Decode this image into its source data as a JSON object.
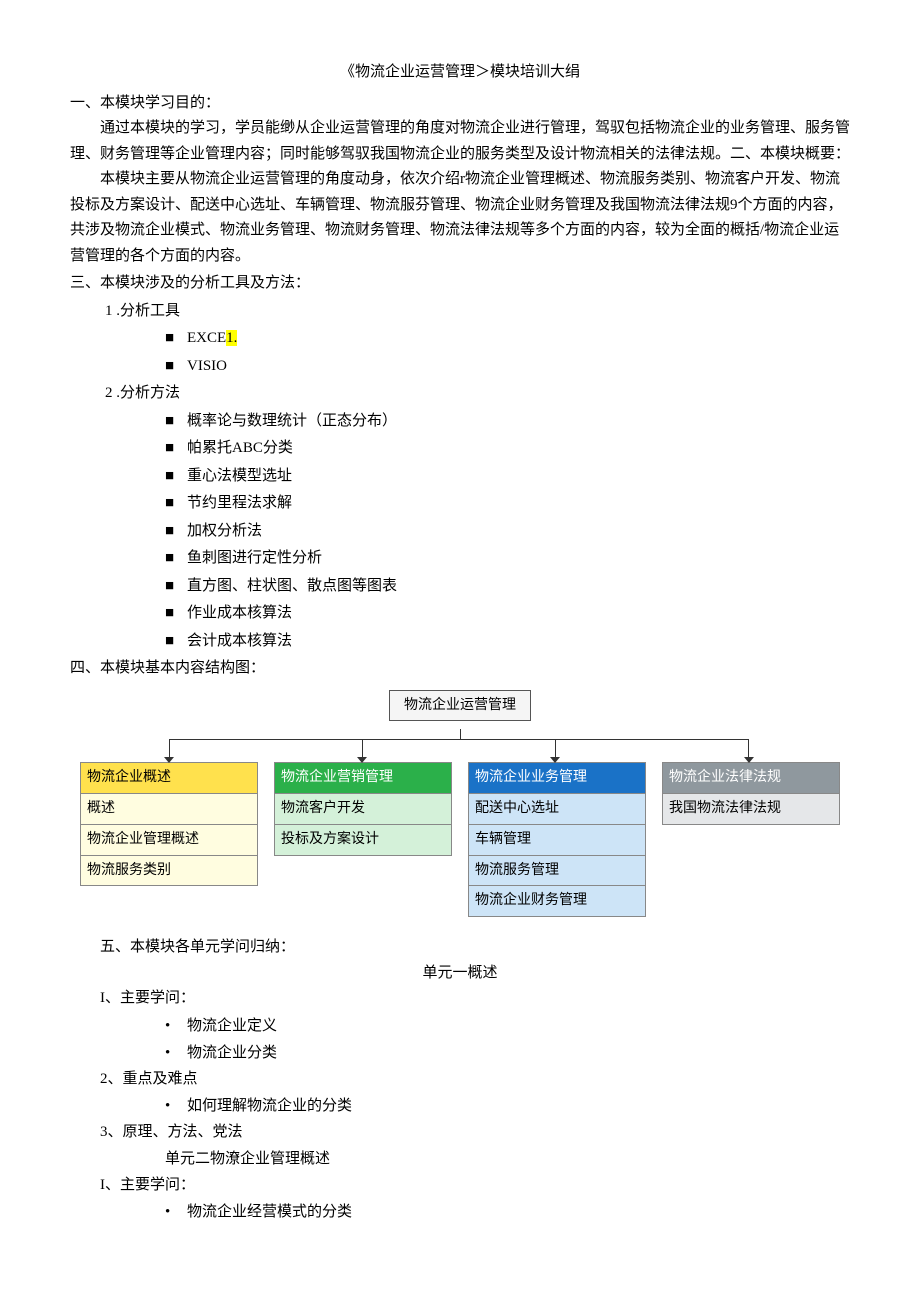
{
  "title": "《物流企业运营管理＞模块培训大绢",
  "s1": {
    "hd": "一、本模块学习目的：",
    "p1": "通过本模块的学习，学员能缈从企业运营管理的角度对物流企业进行管理，驾驭包括物流企业的业务管理、服务管理、财务管理等企业管理内容；同时能够驾驭我国物流企业的服务类型及设计物流相关的法律法规。二、本模块概要：",
    "p2": "本模块主要从物流企业运营管理的角度动身，依次介绍r物流企业管理概述、物流服务类别、物流客户开发、物流投标及方案设计、配送中心选址、车辆管理、物流服芬管理、物流企业财务管理及我国物流法律法规9个方面的内容，共涉及物流企业模式、物流业务管理、物流财务管理、物流法律法规等多个方面的内容，较为全面的概括/物流企业运营管理的各个方面的内容。"
  },
  "s3": {
    "hd": "三、本模块涉及的分析工具及方法：",
    "g1": "1 .分析工具",
    "g1a_prefix": "EXCE",
    "g1a_hl": "1.",
    "g1b": "VISIO",
    "g2": "2  .分析方法",
    "m1": "概率论与数理统计（正态分布）",
    "m2": "帕累托ABC分类",
    "m3": "重心法模型选址",
    "m4": "节约里程法求解",
    "m5": "加权分析法",
    "m6": "鱼刺图进行定性分析",
    "m7": "直方图、柱状图、散点图等图表",
    "m8": "作业成本核算法",
    "m9": "会计成本核算法"
  },
  "s4": {
    "hd": "四、本模块基本内容结构图：",
    "root": "物流企业运营管理",
    "c1h": "物流企业概述",
    "c1a": "概述",
    "c1b": "物流企业管理概述",
    "c1c": "物流服务类别",
    "c2h": "物流企业营销管理",
    "c2a": "物流客户开发",
    "c2b": "投标及方案设计",
    "c3h": "物流企业业务管理",
    "c3a": "配送中心选址",
    "c3b": "车辆管理",
    "c3c": "物流服务管理",
    "c3d": "物流企业财务管理",
    "c4h": "物流企业法律法规",
    "c4a": "我国物流法律法规"
  },
  "s5": {
    "hd": "五、本模块各单元学问归纳：",
    "u1": "单元一概述",
    "u1_1": "I、主要学问：",
    "u1_1a": "物流企业定义",
    "u1_1b": "物流企业分类",
    "u1_2": "2、重点及难点",
    "u1_2a": "如何理解物流企业的分类",
    "u1_3": "3、原理、方法、党法",
    "u2": "单元二物潦企业管理概述",
    "u2_1": "I、主要学问：",
    "u2_1a": "物流企业经营模式的分类"
  }
}
